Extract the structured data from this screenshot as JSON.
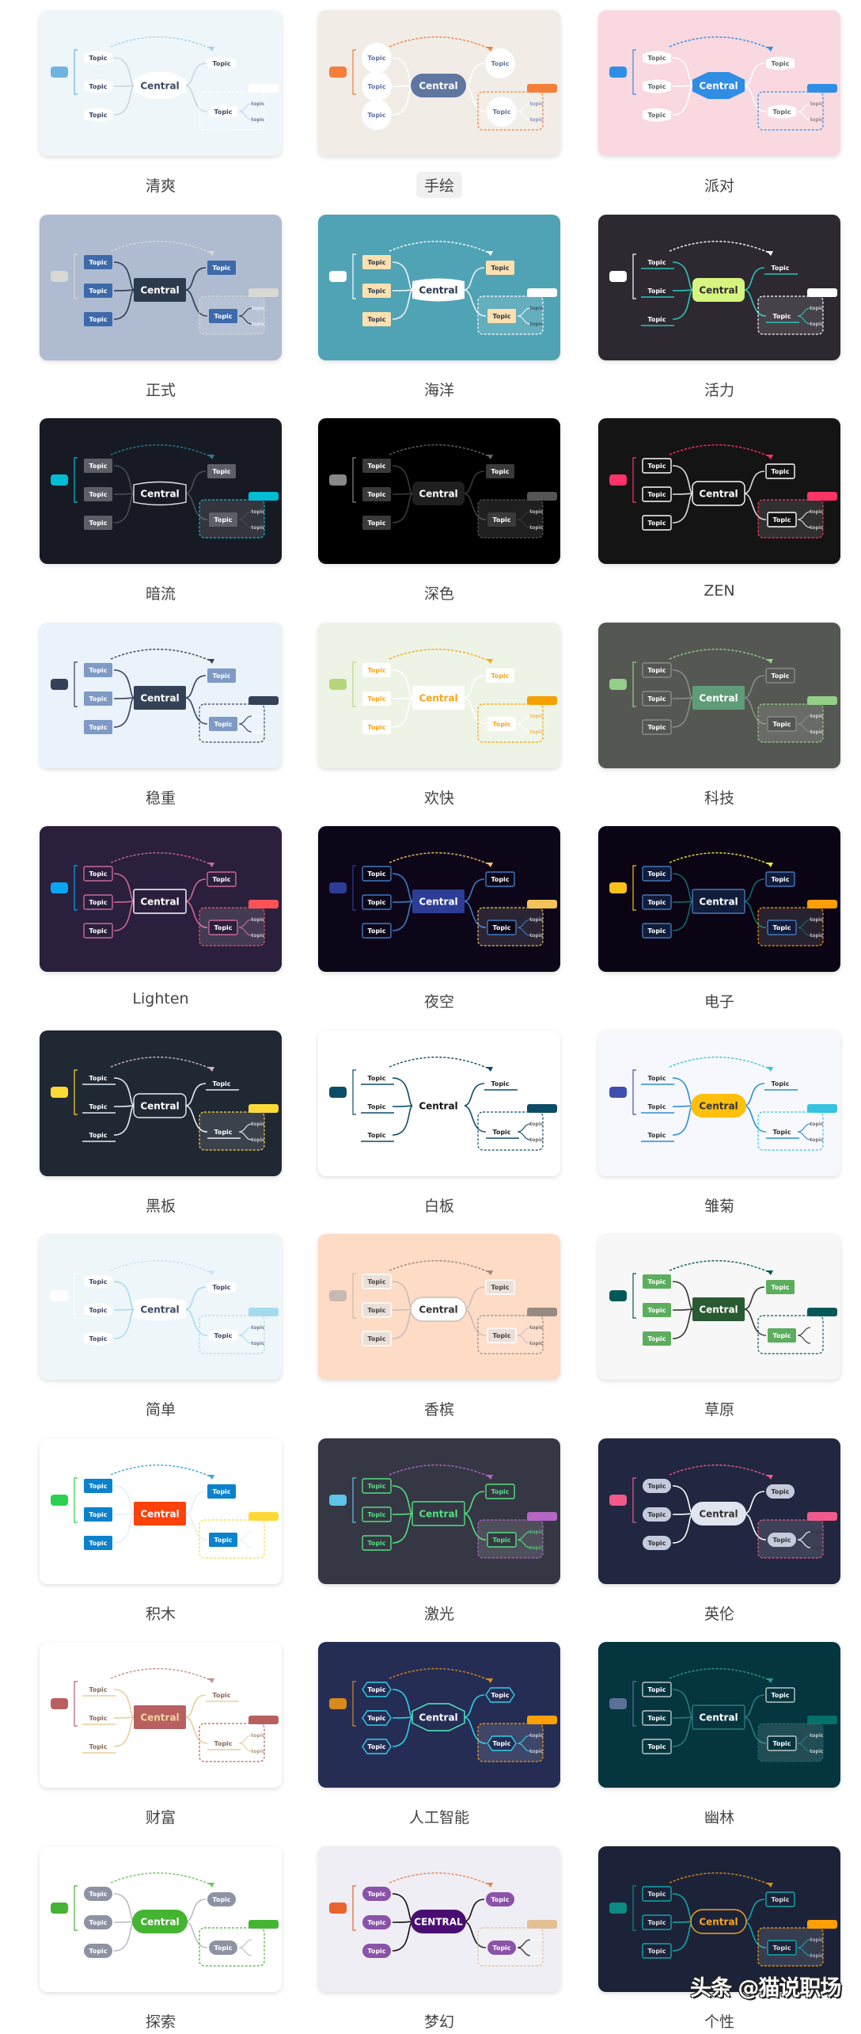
{
  "node_text": {
    "central": "Central",
    "topic": "Topic",
    "subtopic": "topic"
  },
  "themes": [
    {
      "name": "清爽",
      "bg": "#eef6fa",
      "central_fill": "#ffffff",
      "central_text": "#3d4a66",
      "central_stroke": "none",
      "central_shape": "hex",
      "topic_fill": "#ffffff",
      "topic_text": "#3d4a66",
      "topic_stroke": "none",
      "topic_shape": "blob",
      "line": "#c8d6df",
      "accent": "#6fb3e0",
      "summary": "#ffffff",
      "dash": "#a7d0ee",
      "selected": false
    },
    {
      "name": "手绘",
      "bg": "#f1ece6",
      "central_fill": "#5f76a0",
      "central_text": "#ffffff",
      "central_stroke": "none",
      "central_shape": "pill",
      "topic_fill": "#ffffff",
      "topic_text": "#5f76a0",
      "topic_stroke": "none",
      "topic_shape": "circle",
      "line": "#ffffff",
      "accent": "#f47f3a",
      "summary": "#f47f3a",
      "dash": "#f47f3a",
      "selected": true
    },
    {
      "name": "派对",
      "bg": "#f9d8df",
      "central_fill": "#2f8de4",
      "central_text": "#ffffff",
      "central_stroke": "none",
      "central_shape": "hex",
      "topic_fill": "#ffffff",
      "topic_text": "#666666",
      "topic_stroke": "none",
      "topic_shape": "blob",
      "line": "#ffffff",
      "accent": "#2f8de4",
      "summary": "#2f8de4",
      "dash": "#2f8de4",
      "selected": false
    },
    {
      "name": "正式",
      "bg": "#aebbd0",
      "central_fill": "#2c3a4e",
      "central_text": "#ffffff",
      "central_stroke": "none",
      "central_shape": "rect",
      "topic_fill": "#3d6aaa",
      "topic_text": "#ffffff",
      "topic_stroke": "none",
      "topic_shape": "rect",
      "line": "#2c3a4e",
      "accent": "#d8d8d4",
      "summary": "#d8d8d4",
      "dash": "#d8d8d4",
      "selected": false
    },
    {
      "name": "海洋",
      "bg": "#50a3b5",
      "central_fill": "#ffffff",
      "central_text": "#2c3a4e",
      "central_stroke": "none",
      "central_shape": "blob",
      "topic_fill": "#fde0b0",
      "topic_text": "#2c3a4e",
      "topic_stroke": "none",
      "topic_shape": "rect",
      "line": "#e8f4f6",
      "accent": "#ffffff",
      "summary": "#ffffff",
      "dash": "#ffffff",
      "selected": false
    },
    {
      "name": "活力",
      "bg": "#2e2831",
      "central_fill": "#d5f57f",
      "central_text": "#2e2831",
      "central_stroke": "none",
      "central_shape": "round",
      "topic_fill": "none",
      "topic_text": "#ffffff",
      "topic_stroke": "none",
      "topic_shape": "under",
      "line": "#2cc6b8",
      "accent": "#ffffff",
      "summary": "#ffffff",
      "dash": "#ffffff",
      "selected": false
    },
    {
      "name": "暗流",
      "bg": "#181a23",
      "central_fill": "#181a23",
      "central_text": "#ffffff",
      "central_stroke": "#e4e4e4",
      "central_shape": "blob",
      "topic_fill": "#5d5f66",
      "topic_text": "#ffffff",
      "topic_stroke": "none",
      "topic_shape": "rect",
      "line": "#4a4d55",
      "accent": "#00bcd4",
      "summary": "#00bcd4",
      "dash": "#2a7d8e",
      "selected": false
    },
    {
      "name": "深色",
      "bg": "#000000",
      "central_fill": "#1f1f1f",
      "central_text": "#ffffff",
      "central_stroke": "none",
      "central_shape": "round",
      "topic_fill": "#3a3a3a",
      "topic_text": "#ffffff",
      "topic_stroke": "none",
      "topic_shape": "rect",
      "line": "#3a3a3a",
      "accent": "#888888",
      "summary": "#555555",
      "dash": "#666666",
      "selected": false
    },
    {
      "name": "ZEN",
      "bg": "#141414",
      "central_fill": "#141414",
      "central_text": "#ffffff",
      "central_stroke": "#ffffff",
      "central_shape": "round",
      "topic_fill": "#141414",
      "topic_text": "#ffffff",
      "topic_stroke": "#ffffff",
      "topic_shape": "rect",
      "line": "#dddddd",
      "accent": "#ff3366",
      "summary": "#ff3366",
      "dash": "#ff3366",
      "selected": false
    },
    {
      "name": "稳重",
      "bg": "#eaf2fa",
      "central_fill": "#344258",
      "central_text": "#ffffff",
      "central_stroke": "none",
      "central_shape": "rect",
      "topic_fill": "#7e9ac5",
      "topic_text": "#ffffff",
      "topic_stroke": "none",
      "topic_shape": "rect",
      "line": "#344258",
      "accent": "#344258",
      "summary": "#344258",
      "dash": "#344258",
      "selected": false
    },
    {
      "name": "欢快",
      "bg": "#edf4e6",
      "central_fill": "#ffffff",
      "central_text": "#f7a51c",
      "central_stroke": "none",
      "central_shape": "rect",
      "topic_fill": "#ffffff",
      "topic_text": "#f7a51c",
      "topic_stroke": "none",
      "topic_shape": "rect",
      "line": "#ffffff",
      "accent": "#b5d57a",
      "summary": "#f7a000",
      "dash": "#f7a51c",
      "selected": false
    },
    {
      "name": "科技",
      "bg": "#555753",
      "central_fill": "#5f9c78",
      "central_text": "#ffffff",
      "central_stroke": "none",
      "central_shape": "rect",
      "topic_fill": "#555753",
      "topic_text": "#ffffff",
      "topic_stroke": "#8a8c88",
      "topic_shape": "rect",
      "line": "#8a8c88",
      "accent": "#93cf88",
      "summary": "#93cf88",
      "dash": "#93cf88",
      "selected": false
    },
    {
      "name": "Lighten",
      "bg": "#2a1f3d",
      "central_fill": "#2a1f3d",
      "central_text": "#ffffff",
      "central_stroke": "#ffffff",
      "central_shape": "rect",
      "topic_fill": "#2a1f3d",
      "topic_text": "#ffffff",
      "topic_stroke": "#c96a98",
      "topic_shape": "rect",
      "line": "#c96a98",
      "accent": "#0aa5f2",
      "summary": "#ff5257",
      "dash": "#c96a98",
      "selected": false
    },
    {
      "name": "夜空",
      "bg": "#0d0619",
      "central_fill": "#2d3d95",
      "central_text": "#ffffff",
      "central_stroke": "none",
      "central_shape": "rect",
      "topic_fill": "#0d0619",
      "topic_text": "#ffffff",
      "topic_stroke": "#3d7bc2",
      "topic_shape": "rect",
      "line": "#3d7bc2",
      "accent": "#2d3d95",
      "summary": "#f4c35a",
      "dash": "#f4c35a",
      "selected": false
    },
    {
      "name": "电子",
      "bg": "#0b0414",
      "central_fill": "#101c3a",
      "central_text": "#ffffff",
      "central_stroke": "#4677b8",
      "central_shape": "rect",
      "topic_fill": "#101c3a",
      "topic_text": "#ffffff",
      "topic_stroke": "#4677b8",
      "topic_shape": "rect",
      "line": "#0f6b6b",
      "accent": "#fbc01a",
      "summary": "#fba000",
      "dash": "#e9e53b",
      "selected": false
    },
    {
      "name": "黑板",
      "bg": "#202833",
      "central_fill": "#202833",
      "central_text": "#ffffff",
      "central_stroke": "#e6edf5",
      "central_shape": "round",
      "topic_fill": "none",
      "topic_text": "#ffffff",
      "topic_stroke": "none",
      "topic_shape": "under",
      "line": "#e6edf5",
      "accent": "#fcd936",
      "summary": "#fcd936",
      "dash": "#d4b3c7",
      "selected": false
    },
    {
      "name": "白板",
      "bg": "#ffffff",
      "central_fill": "#ffffff",
      "central_text": "#111111",
      "central_stroke": "none",
      "central_shape": "rect",
      "topic_fill": "none",
      "topic_text": "#222222",
      "topic_stroke": "none",
      "topic_shape": "under",
      "line": "#0b4c66",
      "accent": "#0b4c66",
      "summary": "#0b4c66",
      "dash": "#0b4c66",
      "selected": false
    },
    {
      "name": "雏菊",
      "bg": "#f7f8fd",
      "central_fill": "#ffbf0f",
      "central_text": "#333333",
      "central_stroke": "none",
      "central_shape": "pill",
      "topic_fill": "none",
      "topic_text": "#333333",
      "topic_stroke": "none",
      "topic_shape": "under",
      "line": "#2a8ed1",
      "accent": "#3f4fb0",
      "summary": "#35c3e0",
      "dash": "#35c3e0",
      "selected": false
    },
    {
      "name": "简单",
      "bg": "#eef6fa",
      "central_fill": "#ffffff",
      "central_text": "#3d4a66",
      "central_stroke": "none",
      "central_shape": "blob",
      "topic_fill": "#ffffff",
      "topic_text": "#3d4a66",
      "topic_stroke": "none",
      "topic_shape": "blob",
      "line": "#a9dbef",
      "accent": "#ffffff",
      "summary": "#a5dbef",
      "dash": "#c6e4f2",
      "selected": false
    },
    {
      "name": "香槟",
      "bg": "#fddbc5",
      "central_fill": "#ffffff",
      "central_text": "#333333",
      "central_stroke": "#c8beb6",
      "central_shape": "pill",
      "topic_fill": "#eae0d8",
      "topic_text": "#444444",
      "topic_stroke": "#ffffff",
      "topic_shape": "rect",
      "line": "#c8beb6",
      "accent": "#c8b8b0",
      "summary": "#978a80",
      "dash": "#978a80",
      "selected": false
    },
    {
      "name": "草原",
      "bg": "#f7f7f7",
      "central_fill": "#295a32",
      "central_text": "#ffffff",
      "central_stroke": "none",
      "central_shape": "rect",
      "topic_fill": "#5cae5e",
      "topic_text": "#ffffff",
      "topic_stroke": "none",
      "topic_shape": "rect",
      "line": "#333333",
      "accent": "#035959",
      "summary": "#035959",
      "dash": "#035959",
      "selected": false
    },
    {
      "name": "积木",
      "bg": "#ffffff",
      "central_fill": "#fd410a",
      "central_text": "#ffffff",
      "central_stroke": "none",
      "central_shape": "rect",
      "topic_fill": "#0b82cc",
      "topic_text": "#ffffff",
      "topic_stroke": "none",
      "topic_shape": "rect",
      "line": "#e5eef6",
      "accent": "#2ad14e",
      "summary": "#fdd835",
      "dash": "#38a4dd",
      "selected": false
    },
    {
      "name": "激光",
      "bg": "#363745",
      "central_fill": "#363745",
      "central_text": "#52e17e",
      "central_stroke": "#52e17e",
      "central_shape": "rect",
      "topic_fill": "#363745",
      "topic_text": "#52e17e",
      "topic_stroke": "#52e17e",
      "topic_shape": "rect",
      "line": "#52e17e",
      "accent": "#5ec4e8",
      "summary": "#b766c5",
      "dash": "#b766c5",
      "selected": false
    },
    {
      "name": "英伦",
      "bg": "#212740",
      "central_fill": "#e0e4ee",
      "central_text": "#333333",
      "central_stroke": "none",
      "central_shape": "pill",
      "topic_fill": "#c5cbdc",
      "topic_text": "#333333",
      "topic_stroke": "none",
      "topic_shape": "pill",
      "line": "#ffffff",
      "accent": "#f25a8c",
      "summary": "#f25a8c",
      "dash": "#f25a8c",
      "selected": false
    },
    {
      "name": "财富",
      "bg": "#ffffff",
      "central_fill": "#b86060",
      "central_text": "#f0d6a0",
      "central_stroke": "none",
      "central_shape": "rect",
      "topic_fill": "none",
      "topic_text": "#8a6a5a",
      "topic_stroke": "none",
      "topic_shape": "under",
      "line": "#e6cf9a",
      "accent": "#b86060",
      "summary": "#b86060",
      "dash": "#c98a8a",
      "selected": false
    },
    {
      "name": "人工智能",
      "bg": "#252d55",
      "central_fill": "#252d55",
      "central_text": "#ffffff",
      "central_stroke": "#52f0c0",
      "central_shape": "hex",
      "topic_fill": "#252d55",
      "topic_text": "#ffffff",
      "topic_stroke": "#2fd0e8",
      "topic_shape": "hex",
      "line": "#2fd0e8",
      "accent": "#d88a1a",
      "summary": "#ffa000",
      "dash": "#d88a1a",
      "selected": false
    },
    {
      "name": "幽林",
      "bg": "#05353e",
      "central_fill": "#05353e",
      "central_text": "#ffffff",
      "central_stroke": "#2a7c7e",
      "central_shape": "rect",
      "topic_fill": "#05353e",
      "topic_text": "#ffffff",
      "topic_stroke": "#b9c9c9",
      "topic_shape": "rect",
      "line": "#2a7c7e",
      "accent": "#5c7096",
      "summary": "#05706a",
      "dash": "#2a9c9a",
      "selected": false
    },
    {
      "name": "探索",
      "bg": "#ffffff",
      "central_fill": "#45b432",
      "central_text": "#ffffff",
      "central_stroke": "none",
      "central_shape": "pill",
      "topic_fill": "#8d93a3",
      "topic_text": "#ffffff",
      "topic_stroke": "none",
      "topic_shape": "pill",
      "line": "#b8bcc6",
      "accent": "#45b432",
      "summary": "#45b432",
      "dash": "#6cc65e",
      "selected": false
    },
    {
      "name": "梦幻",
      "bg": "#eeeef4",
      "central_fill": "#4a0e73",
      "central_text": "#ffffff",
      "central_stroke": "none",
      "central_shape": "pill",
      "topic_fill": "#8a52a8",
      "topic_text": "#ffffff",
      "topic_stroke": "none",
      "topic_shape": "pill",
      "line": "#111111",
      "accent": "#e8632e",
      "summary": "#e2c096",
      "dash": "#e8834e",
      "selected": false
    },
    {
      "name": "个性",
      "bg": "#1c2339",
      "central_fill": "#1c2339",
      "central_text": "#f5a623",
      "central_stroke": "#f5a623",
      "central_shape": "pill",
      "topic_fill": "#1c2339",
      "topic_text": "#dddddd",
      "topic_stroke": "#12a6aa",
      "topic_shape": "rect",
      "line": "#12a6aa",
      "accent": "#0e8a84",
      "summary": "#ffa000",
      "dash": "#d88a1a",
      "selected": false
    }
  ],
  "watermark": "头条 @猫说职场"
}
